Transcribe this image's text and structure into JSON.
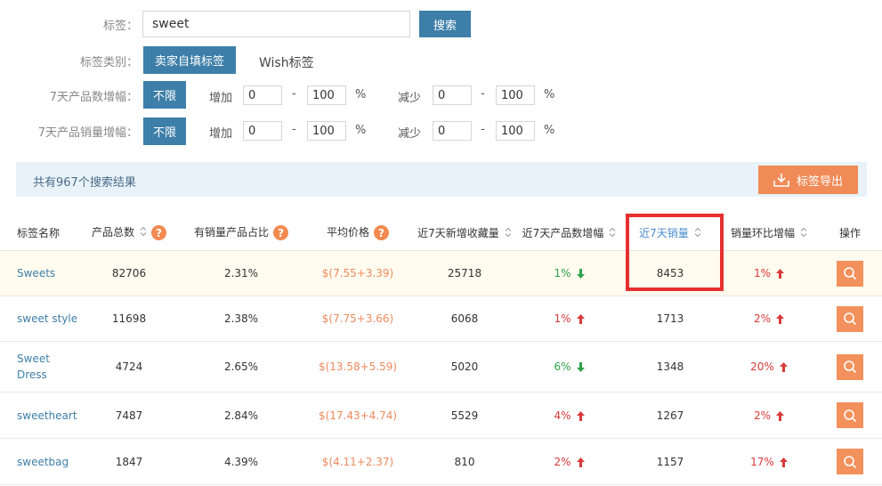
{
  "filters": {
    "tag_label": "标签：",
    "tag_value": "sweet",
    "search_button": "搜索",
    "type_label": "标签类别：",
    "type_selected": "卖家自填标签",
    "type_other": "Wish标签",
    "product_growth_label": "7天产品数增幅：",
    "sales_growth_label": "7天产品销量增幅：",
    "unlimited": "不限",
    "increase": "增加",
    "decrease": "减少",
    "dash": "-",
    "percent": "%",
    "product_growth": {
      "inc_min": "0",
      "inc_max": "100",
      "dec_min": "0",
      "dec_max": "100"
    },
    "sales_growth": {
      "inc_min": "0",
      "inc_max": "100",
      "dec_min": "0",
      "dec_max": "100"
    }
  },
  "result_bar": {
    "summary": "共有967个搜索结果",
    "export_button": "标签导出"
  },
  "table": {
    "headers": [
      "标签名称",
      "产品总数",
      "有销量产品占比",
      "平均价格",
      "近7天新增收藏量",
      "近7天产品数增幅",
      "近7天销量",
      "销量环比增幅",
      "操作"
    ],
    "rows": [
      {
        "name": "Sweets",
        "total": "82706",
        "ratio": "2.31%",
        "price": "$(7.55+3.39)",
        "fav": "25718",
        "growth": "1%",
        "growth_dir": "down",
        "sales": "8453",
        "mom": "1%",
        "mom_dir": "up"
      },
      {
        "name": "sweet style",
        "total": "11698",
        "ratio": "2.38%",
        "price": "$(7.75+3.66)",
        "fav": "6068",
        "growth": "1%",
        "growth_dir": "up",
        "sales": "1713",
        "mom": "2%",
        "mom_dir": "up"
      },
      {
        "name": "Sweet Dress",
        "total": "4724",
        "ratio": "2.65%",
        "price": "$(13.58+5.59)",
        "fav": "5020",
        "growth": "6%",
        "growth_dir": "down",
        "sales": "1348",
        "mom": "20%",
        "mom_dir": "up"
      },
      {
        "name": "sweetheart",
        "total": "7487",
        "ratio": "2.84%",
        "price": "$(17.43+4.74)",
        "fav": "5529",
        "growth": "4%",
        "growth_dir": "up",
        "sales": "1267",
        "mom": "2%",
        "mom_dir": "up"
      },
      {
        "name": "sweetbag",
        "total": "1847",
        "ratio": "4.39%",
        "price": "$(4.11+2.37)",
        "fav": "810",
        "growth": "2%",
        "growth_dir": "up",
        "sales": "1157",
        "mom": "17%",
        "mom_dir": "up"
      }
    ]
  },
  "colors": {
    "primary": "#3e7fa9",
    "accent": "#f08b57",
    "up": "#d83a3a",
    "down": "#2ea24a",
    "highlight": "#e63030"
  },
  "icons": {
    "help": "question-icon",
    "sort": "sort-icon",
    "search": "search-icon",
    "export": "download-icon"
  }
}
